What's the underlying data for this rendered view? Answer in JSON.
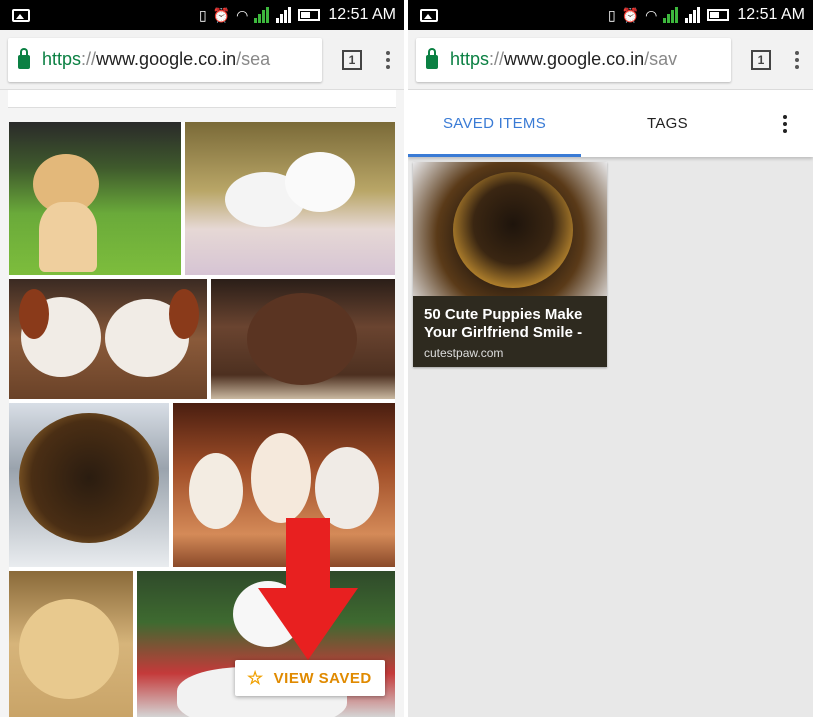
{
  "status_bar": {
    "time": "12:51 AM"
  },
  "left": {
    "url": {
      "scheme": "https",
      "separator": "://",
      "host": "www.google.co.in",
      "path": "/sea"
    },
    "tab_count": "1",
    "view_saved_button": "VIEW SAVED"
  },
  "right": {
    "url": {
      "scheme": "https",
      "separator": "://",
      "host": "www.google.co.in",
      "path": "/sav"
    },
    "tab_count": "1",
    "tabs": [
      {
        "label": "SAVED ITEMS",
        "active": true
      },
      {
        "label": "TAGS",
        "active": false
      }
    ],
    "saved_item": {
      "title": "50 Cute Puppies Make Your Girlfriend Smile -",
      "source": "cutestpaw.com"
    }
  },
  "colors": {
    "secure_green": "#0b8043",
    "active_tab": "#3a7bd5",
    "view_saved": "#e08a00",
    "arrow": "#e82020"
  }
}
